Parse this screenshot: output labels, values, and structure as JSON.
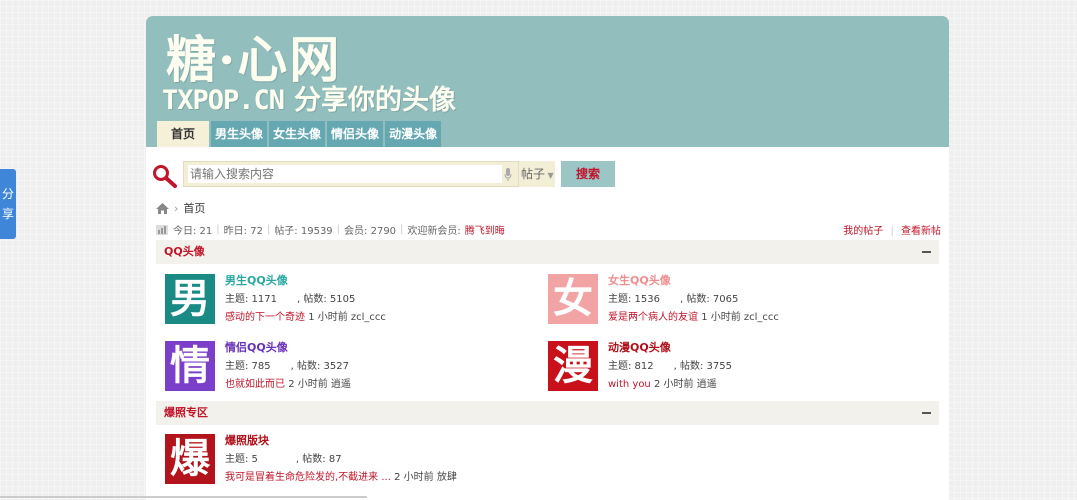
{
  "share": {
    "label_1": "分",
    "label_2": "享"
  },
  "header": {
    "logo_main": "糖·心网",
    "logo_domain": "TXPOP.CN",
    "logo_tagline": "分享你的头像",
    "nav": [
      {
        "label": "首页",
        "active": true
      },
      {
        "label": "男生头像"
      },
      {
        "label": "女生头像"
      },
      {
        "label": "情侣头像"
      },
      {
        "label": "动漫头像"
      }
    ]
  },
  "search": {
    "placeholder": "请输入搜索内容",
    "type_label": "帖子",
    "button_label": "搜索"
  },
  "breadcrumb": {
    "home_icon": "home-icon",
    "current": "首页"
  },
  "stats": {
    "today": "今日: 21",
    "yesterday": "昨日: 72",
    "posts": "帖子: 19539",
    "members": "会员: 2790",
    "welcome": "欢迎新会员:",
    "new_member": "腾飞到晦",
    "my_posts": "我的帖子",
    "view_new": "查看新帖"
  },
  "sections": [
    {
      "title": "QQ头像",
      "forums": [
        {
          "icon_char": "男",
          "color": "#1a8a85",
          "name": "男生QQ头像",
          "name_color": "#2aa8a0",
          "threads": "主题: 1171",
          "posts": ", 帖数: 5105",
          "last_title": "感动的下一个奇迹",
          "last_meta": "1 小时前 zcl_ccc"
        },
        {
          "icon_char": "女",
          "color": "#f2a3a3",
          "name": "女生QQ头像",
          "name_color": "#ee8f8f",
          "threads": "主题: 1536",
          "posts": ", 帖数: 7065",
          "last_title": "爱是两个病人的友谊",
          "last_meta": "1 小时前 zcl_ccc"
        },
        {
          "icon_char": "情",
          "color": "#7b3fc9",
          "name": "情侣QQ头像",
          "name_color": "#6a30b8",
          "threads": "主题: 785",
          "posts": ", 帖数: 3527",
          "last_title": "也就如此而已",
          "last_meta": "2 小时前 逍遥"
        },
        {
          "icon_char": "漫",
          "color": "#c8111a",
          "name": "动漫QQ头像",
          "name_color": "#b0101a",
          "threads": "主题: 812",
          "posts": ", 帖数: 3755",
          "last_title": "with you",
          "last_meta": "2 小时前 逍遥"
        }
      ]
    },
    {
      "title": "爆照专区",
      "forums": [
        {
          "icon_char": "爆",
          "color": "#b3141c",
          "name": "爆照版块",
          "name_color": "#b0101a",
          "threads": "主题: 5",
          "posts": ", 帖数: 87",
          "last_title": "我可是冒着生命危险发的,不截进来 ...",
          "last_meta": "2 小时前 放肆"
        }
      ]
    }
  ]
}
